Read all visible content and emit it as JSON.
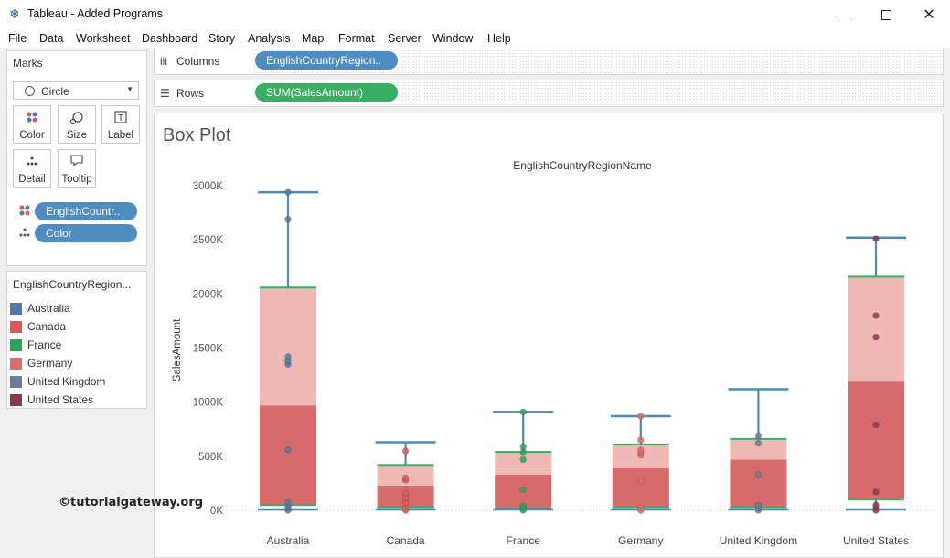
{
  "window": {
    "title": "Tableau - Added Programs",
    "app_icon": "tableau-logo-icon",
    "controls": [
      "minimize",
      "maximize",
      "close"
    ]
  },
  "menu": [
    "File",
    "Data",
    "Worksheet",
    "Dashboard",
    "Story",
    "Analysis",
    "Map",
    "Format",
    "Server",
    "Window",
    "Help"
  ],
  "marks": {
    "label": "Marks",
    "mark_type": "Circle",
    "buttons": [
      {
        "label": "Color",
        "icon": "color-dots-icon"
      },
      {
        "label": "Size",
        "icon": "size-icon"
      },
      {
        "label": "Label",
        "icon": "label-t-icon"
      },
      {
        "label": "Detail",
        "icon": "detail-dots-icon"
      },
      {
        "label": "Tooltip",
        "icon": "tooltip-bubble-icon"
      }
    ],
    "pills": [
      "EnglishCountr..",
      "Color"
    ]
  },
  "legend": {
    "title": "EnglishCountryRegion...",
    "items": [
      {
        "label": "Australia",
        "color": "#4e79a7"
      },
      {
        "label": "Canada",
        "color": "#e15759"
      },
      {
        "label": "France",
        "color": "#2ca35a"
      },
      {
        "label": "Germany",
        "color": "#e06b6b"
      },
      {
        "label": "United Kingdom",
        "color": "#6b7b99"
      },
      {
        "label": "United States",
        "color": "#8b3a4a"
      }
    ]
  },
  "shelves": {
    "columns": {
      "label": "Columns",
      "pill": "EnglishCountryRegion.."
    },
    "rows": {
      "label": "Rows",
      "pill": "SUM(SalesAmount)"
    }
  },
  "sheet": {
    "title": "Box Plot",
    "watermark": "©tutorialgateway.org"
  },
  "chart_data": {
    "type": "box",
    "title": "",
    "column_header": "EnglishCountryRegionName",
    "ylabel": "SalesAmount",
    "ylim": [
      0,
      3000000
    ],
    "ytick_labels": [
      "0K",
      "500K",
      "1000K",
      "1500K",
      "2000K",
      "2500K",
      "3000K"
    ],
    "ytick_values": [
      0,
      500000,
      1000000,
      1500000,
      2000000,
      2500000,
      3000000
    ],
    "grid": false,
    "box_colors": {
      "lower": "#d76b6b",
      "upper": "#f1b9b6",
      "whisker": "#4e8ab8",
      "hinge": "#3aae63"
    },
    "categories": [
      "Australia",
      "Canada",
      "France",
      "Germany",
      "United Kingdom",
      "United States"
    ],
    "boxes": [
      {
        "name": "Australia",
        "min": 0,
        "q1": 50000,
        "median": 970000,
        "q3": 2060000,
        "max": 2940000,
        "points": [
          0,
          20000,
          40000,
          80000,
          560000,
          1350000,
          1380000,
          1420000,
          2690000,
          2940000
        ]
      },
      {
        "name": "Canada",
        "min": 0,
        "q1": 30000,
        "median": 230000,
        "q3": 420000,
        "max": 630000,
        "points": [
          0,
          20000,
          70000,
          120000,
          160000,
          280000,
          300000,
          550000
        ]
      },
      {
        "name": "France",
        "min": 0,
        "q1": 20000,
        "median": 330000,
        "q3": 540000,
        "max": 910000,
        "points": [
          0,
          20000,
          40000,
          190000,
          470000,
          540000,
          590000,
          910000
        ]
      },
      {
        "name": "Germany",
        "min": 0,
        "q1": 30000,
        "median": 390000,
        "q3": 610000,
        "max": 870000,
        "points": [
          0,
          20000,
          270000,
          510000,
          540000,
          560000,
          650000,
          870000
        ]
      },
      {
        "name": "United Kingdom",
        "min": 0,
        "q1": 30000,
        "median": 470000,
        "q3": 660000,
        "max": 1120000,
        "points": [
          0,
          20000,
          50000,
          330000,
          620000,
          690000
        ]
      },
      {
        "name": "United States",
        "min": 0,
        "q1": 100000,
        "median": 1190000,
        "q3": 2160000,
        "max": 2520000,
        "points": [
          0,
          20000,
          50000,
          170000,
          790000,
          1600000,
          1800000,
          2510000
        ]
      }
    ]
  }
}
